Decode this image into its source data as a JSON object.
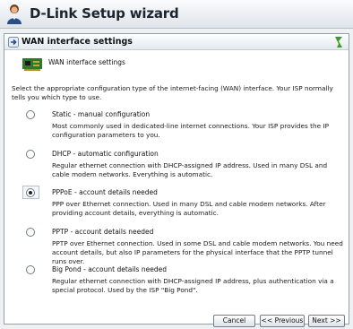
{
  "window": {
    "title": "D-Link Setup wizard",
    "icon": "user-avatar-icon"
  },
  "panel": {
    "header_title": "WAN interface settings",
    "header_icon": "arrow-right-icon",
    "help_icon": "help-icon",
    "section_title": "WAN interface settings",
    "section_icon": "network-card-icon",
    "intro": "Select the appropriate configuration type of the internet-facing (WAN) interface. Your ISP normally tells you which type to use."
  },
  "options": [
    {
      "title": "Static - manual configuration",
      "desc": "Most commonly used in dedicated-line internet connections. Your ISP provides the IP configuration parameters to you.",
      "selected": false
    },
    {
      "title": "DHCP - automatic configuration",
      "desc": "Regular ethernet connection with DHCP-assigned IP address. Used in many DSL and cable modem networks. Everything is automatic.",
      "selected": false
    },
    {
      "title": "PPPoE - account details needed",
      "desc": "PPP over Ethernet connection. Used in many DSL and cable modem networks. After providing account details, everything is automatic.",
      "selected": true
    },
    {
      "title": "PPTP - account details needed",
      "desc": "PPTP over Ethernet connection. Used in some DSL and cable modem networks. You need account details, but also IP parameters for the physical interface that the PPTP tunnel runs over.",
      "selected": false
    },
    {
      "title": "Big Pond - account details needed",
      "desc": "Regular ethernet connection with DHCP-assigned IP address, plus authentication via a special protocol. Used by the ISP \"Big Pond\".",
      "selected": false
    }
  ],
  "buttons": {
    "cancel": "Cancel",
    "previous": "<< Previous",
    "next": "Next >>"
  }
}
